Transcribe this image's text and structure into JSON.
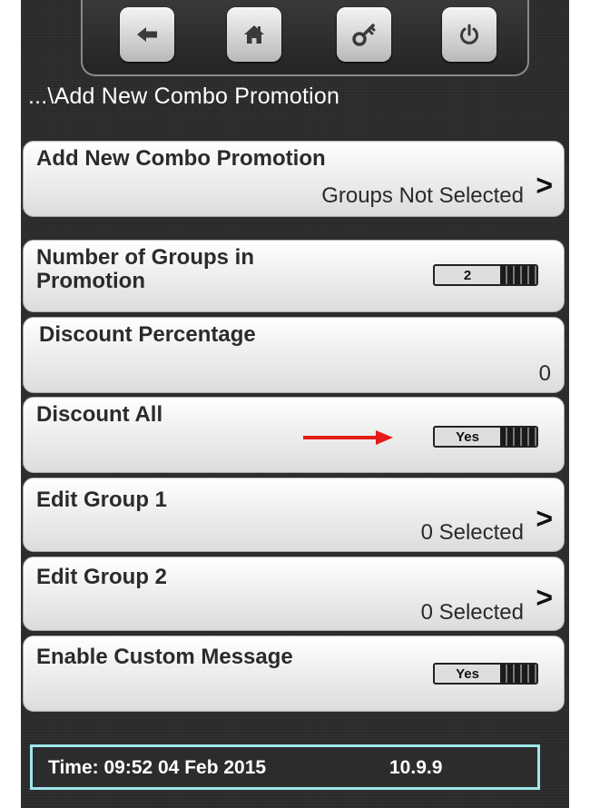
{
  "breadcrumb": "...\\Add New Combo Promotion",
  "toolbar": {
    "buttons": [
      {
        "icon": "back-arrow-icon"
      },
      {
        "icon": "home-icon"
      },
      {
        "icon": "key-icon"
      },
      {
        "icon": "power-icon"
      }
    ]
  },
  "rows": {
    "add_new": {
      "title": "Add New Combo Promotion",
      "value": "Groups Not Selected",
      "chevron": ">"
    },
    "num_groups": {
      "title_line1": "Number of Groups in",
      "title_line2": "Promotion",
      "value": "2"
    },
    "discount_pct": {
      "title": "Discount Percentage",
      "value": "0"
    },
    "discount_all": {
      "title": "Discount All",
      "value": "Yes"
    },
    "edit_group_1": {
      "title": "Edit Group 1",
      "value": "0 Selected",
      "chevron": ">"
    },
    "edit_group_2": {
      "title": "Edit Group 2",
      "value": "0 Selected",
      "chevron": ">"
    },
    "custom_message": {
      "title": "Enable Custom Message",
      "value": "Yes"
    }
  },
  "status": {
    "time": "Time: 09:52  04 Feb 2015",
    "version": "10.9.9"
  },
  "colors": {
    "status_border": "#9ee6ec",
    "annotation_arrow": "#e41b17"
  }
}
